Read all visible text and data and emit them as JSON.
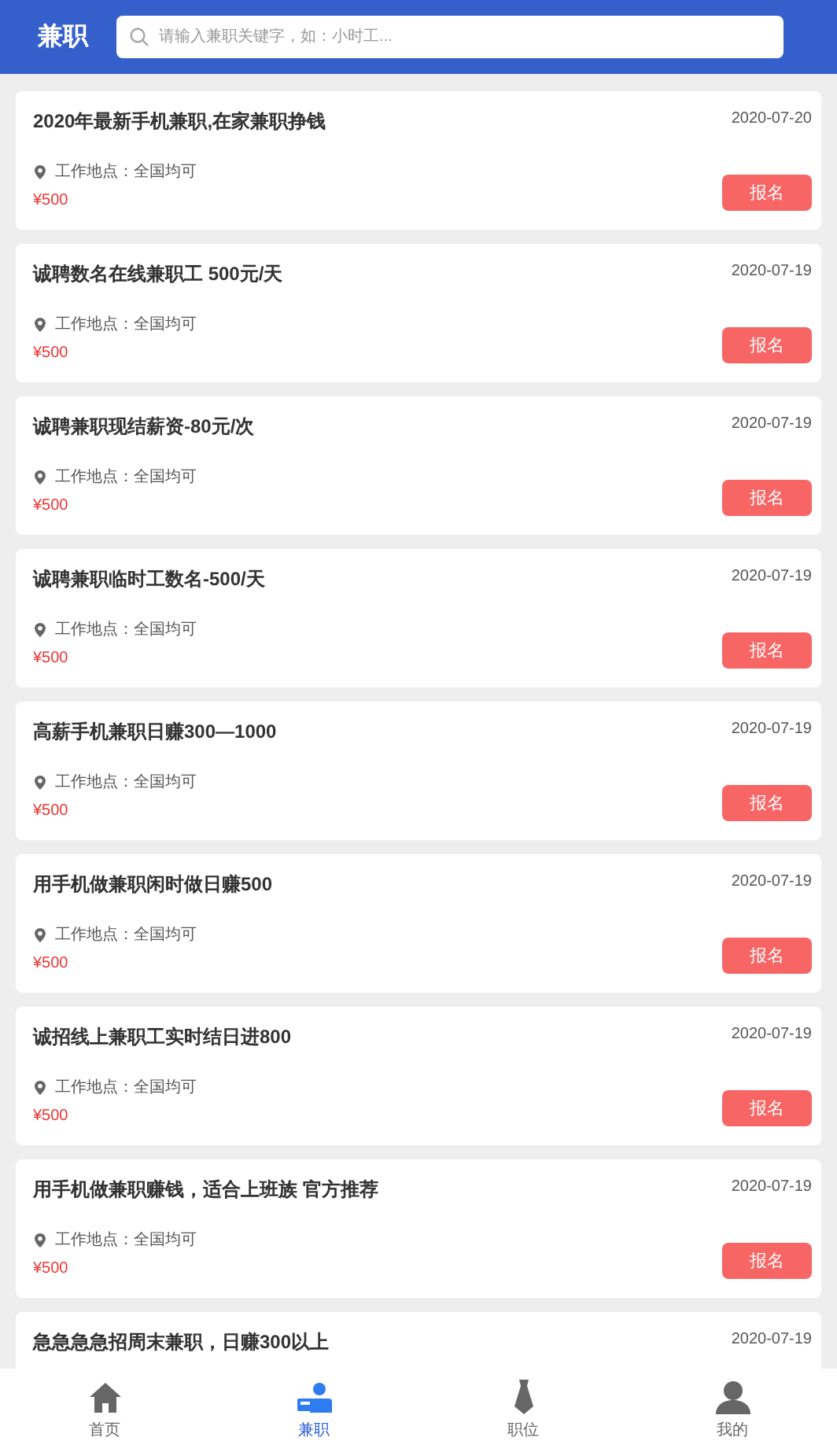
{
  "header": {
    "title": "兼职",
    "search": {
      "placeholder": "请输入兼职关键字，如：小时工..."
    }
  },
  "jobs": [
    {
      "title": "2020年最新手机兼职,在家兼职挣钱",
      "date": "2020-07-20",
      "location": "工作地点：全国均可",
      "pay": "¥500",
      "button": "报名"
    },
    {
      "title": "诚聘数名在线兼职工 500元/天",
      "date": "2020-07-19",
      "location": "工作地点：全国均可",
      "pay": "¥500",
      "button": "报名"
    },
    {
      "title": "诚聘兼职现结薪资-80元/次",
      "date": "2020-07-19",
      "location": "工作地点：全国均可",
      "pay": "¥500",
      "button": "报名"
    },
    {
      "title": "诚聘兼职临时工数名-500/天",
      "date": "2020-07-19",
      "location": "工作地点：全国均可",
      "pay": "¥500",
      "button": "报名"
    },
    {
      "title": "高薪手机兼职日赚300—1000",
      "date": "2020-07-19",
      "location": "工作地点：全国均可",
      "pay": "¥500",
      "button": "报名"
    },
    {
      "title": "用手机做兼职闲时做日赚500",
      "date": "2020-07-19",
      "location": "工作地点：全国均可",
      "pay": "¥500",
      "button": "报名"
    },
    {
      "title": "诚招线上兼职工实时结日进800",
      "date": "2020-07-19",
      "location": "工作地点：全国均可",
      "pay": "¥500",
      "button": "报名"
    },
    {
      "title": "用手机做兼职赚钱，适合上班族 官方推荐",
      "date": "2020-07-19",
      "location": "工作地点：全国均可",
      "pay": "¥500",
      "button": "报名"
    },
    {
      "title": "急急急急招周末兼职，日赚300以上",
      "date": "2020-07-19"
    }
  ],
  "tab_bar": [
    {
      "kind": "home",
      "label": "首页",
      "selected": false
    },
    {
      "kind": "parttime",
      "label": "兼职",
      "selected": true
    },
    {
      "kind": "position",
      "label": "职位",
      "selected": false
    },
    {
      "kind": "mine",
      "label": "我的",
      "selected": false
    }
  ]
}
